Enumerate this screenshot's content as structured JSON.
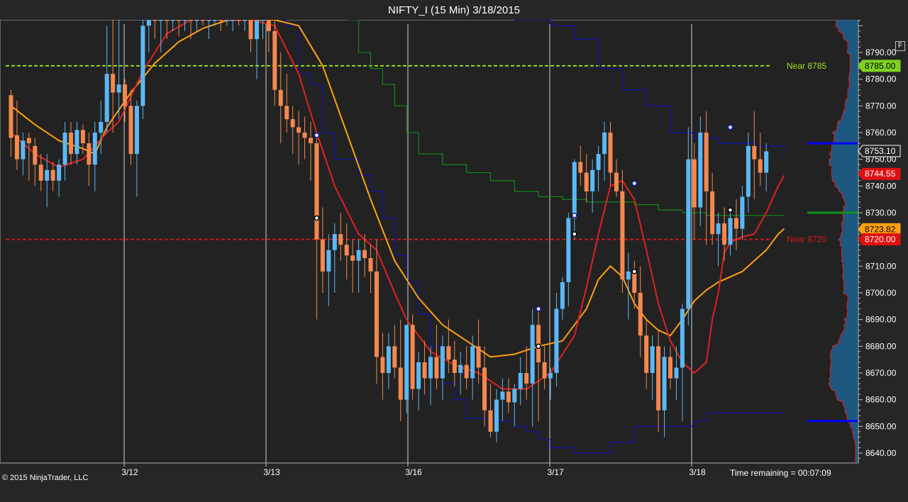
{
  "window": {
    "title": "NIFTY_I (15 Min)  3/18/2015",
    "f_button": "F"
  },
  "footer": {
    "copyright": "© 2015 NinjaTrader, LLC",
    "time_remaining": "Time remaining = 00:07:09"
  },
  "colors": {
    "background": "#262626",
    "panel": "#222222",
    "bar_up": "#5bb8f5",
    "bar_down": "#f5884e",
    "ema_fast": "#e02020",
    "ema_slow": "#ffa010",
    "band": "#1010b0",
    "vwap": "#10901a",
    "near_upper": "#a0e020",
    "near_lower": "#d01818",
    "profile": "#1d6aa0",
    "profile_outline": "#e02020"
  },
  "chart_data": {
    "type": "candlestick",
    "title": "NIFTY_I (15 Min)  3/18/2015",
    "y_range": [
      8635,
      8805
    ],
    "y_ticks": [
      8640,
      8650,
      8660,
      8670,
      8680,
      8690,
      8700,
      8710,
      8720,
      8730,
      8740,
      8750,
      8760,
      8770,
      8780,
      8790
    ],
    "x_day_labels": [
      "3/12",
      "3/13",
      "3/16",
      "3/17",
      "3/18"
    ],
    "grid": false,
    "near_levels": [
      {
        "label": "Near 8785",
        "value": 8785,
        "color": "#a0e020"
      },
      {
        "label": "Near 8720",
        "value": 8720,
        "color": "#d01818"
      }
    ],
    "price_markers": [
      {
        "label": "8785.00",
        "value": 8785,
        "style": "green"
      },
      {
        "label": "8753.10",
        "value": 8753.1,
        "style": "dark"
      },
      {
        "label": "8744.55",
        "value": 8744.55,
        "style": "red"
      },
      {
        "label": "8723.82",
        "value": 8723.82,
        "style": "orange"
      },
      {
        "label": "8720.00",
        "value": 8720,
        "style": "red"
      }
    ],
    "profile_levels": [
      {
        "value": 8756,
        "color": "#0000ff"
      },
      {
        "value": 8730,
        "color": "#10901a"
      },
      {
        "value": 8652,
        "color": "#0000ff"
      }
    ],
    "candles": [
      [
        8774,
        8776,
        8751,
        8758
      ],
      [
        8759,
        8772,
        8746,
        8750
      ],
      [
        8750,
        8760,
        8744,
        8757
      ],
      [
        8758,
        8760,
        8742,
        8756
      ],
      [
        8755,
        8758,
        8740,
        8748
      ],
      [
        8748,
        8752,
        8738,
        8742
      ],
      [
        8742,
        8752,
        8732,
        8746
      ],
      [
        8746,
        8749,
        8738,
        8742
      ],
      [
        8742,
        8750,
        8736,
        8748
      ],
      [
        8748,
        8764,
        8742,
        8760
      ],
      [
        8760,
        8764,
        8748,
        8752
      ],
      [
        8752,
        8764,
        8748,
        8761
      ],
      [
        8761,
        8763,
        8752,
        8756
      ],
      [
        8756,
        8760,
        8740,
        8748
      ],
      [
        8748,
        8764,
        8738,
        8760
      ],
      [
        8760,
        8772,
        8752,
        8764
      ],
      [
        8764,
        8800,
        8760,
        8782
      ],
      [
        8782,
        8806,
        8760,
        8775
      ],
      [
        8775,
        8806,
        8765,
        8778
      ],
      [
        8778,
        8780,
        8764,
        8770
      ],
      [
        8770,
        8776,
        8748,
        8752
      ],
      [
        8752,
        8772,
        8736,
        8770
      ],
      [
        8770,
        8805,
        8765,
        8800
      ],
      [
        8800,
        8806,
        8790,
        8805
      ],
      [
        8805,
        8806,
        8795,
        8802
      ],
      [
        8802,
        8806,
        8790,
        8804
      ],
      [
        8804,
        8806,
        8795,
        8803
      ],
      [
        8803,
        8806,
        8798,
        8805
      ],
      [
        8805,
        8806,
        8796,
        8803
      ],
      [
        8803,
        8806,
        8798,
        8805
      ],
      [
        8805,
        8806,
        8795,
        8804
      ],
      [
        8804,
        8806,
        8798,
        8805
      ],
      [
        8805,
        8806,
        8800,
        8803
      ],
      [
        8803,
        8806,
        8795,
        8804
      ],
      [
        8804,
        8806,
        8800,
        8805
      ],
      [
        8805,
        8806,
        8798,
        8803
      ],
      [
        8803,
        8806,
        8800,
        8805
      ],
      [
        8805,
        8806,
        8798,
        8806
      ],
      [
        8806,
        8806,
        8800,
        8804
      ],
      [
        8804,
        8806,
        8798,
        8805
      ],
      [
        8805,
        8806,
        8790,
        8795
      ],
      [
        8795,
        8806,
        8780,
        8802
      ],
      [
        8802,
        8806,
        8795,
        8806
      ],
      [
        8806,
        8806,
        8790,
        8798
      ],
      [
        8798,
        8806,
        8770,
        8776
      ],
      [
        8776,
        8790,
        8756,
        8770
      ],
      [
        8770,
        8782,
        8760,
        8765
      ],
      [
        8765,
        8770,
        8752,
        8762
      ],
      [
        8762,
        8768,
        8748,
        8760
      ],
      [
        8760,
        8766,
        8750,
        8758
      ],
      [
        8758,
        8764,
        8742,
        8756
      ],
      [
        8756,
        8760,
        8690,
        8720
      ],
      [
        8720,
        8732,
        8700,
        8708
      ],
      [
        8708,
        8722,
        8695,
        8716
      ],
      [
        8716,
        8726,
        8700,
        8722
      ],
      [
        8722,
        8730,
        8712,
        8718
      ],
      [
        8718,
        8726,
        8705,
        8714
      ],
      [
        8714,
        8720,
        8700,
        8712
      ],
      [
        8712,
        8720,
        8700,
        8716
      ],
      [
        8716,
        8722,
        8706,
        8713
      ],
      [
        8713,
        8718,
        8700,
        8708
      ],
      [
        8708,
        8720,
        8666,
        8676
      ],
      [
        8676,
        8685,
        8660,
        8670
      ],
      [
        8670,
        8685,
        8664,
        8680
      ],
      [
        8680,
        8688,
        8668,
        8672
      ],
      [
        8672,
        8690,
        8652,
        8660
      ],
      [
        8660,
        8688,
        8655,
        8688
      ],
      [
        8688,
        8692,
        8660,
        8664
      ],
      [
        8664,
        8678,
        8656,
        8674
      ],
      [
        8674,
        8682,
        8662,
        8668
      ],
      [
        8668,
        8680,
        8658,
        8676
      ],
      [
        8676,
        8688,
        8664,
        8668
      ],
      [
        8668,
        8684,
        8660,
        8680
      ],
      [
        8680,
        8690,
        8670,
        8675
      ],
      [
        8675,
        8682,
        8665,
        8670
      ],
      [
        8670,
        8678,
        8662,
        8673
      ],
      [
        8673,
        8680,
        8664,
        8668
      ],
      [
        8668,
        8684,
        8660,
        8680
      ],
      [
        8680,
        8690,
        8666,
        8672
      ],
      [
        8672,
        8680,
        8650,
        8656
      ],
      [
        8656,
        8666,
        8646,
        8648
      ],
      [
        8648,
        8664,
        8644,
        8660
      ],
      [
        8660,
        8668,
        8652,
        8663
      ],
      [
        8663,
        8668,
        8655,
        8659
      ],
      [
        8659,
        8666,
        8650,
        8664
      ],
      [
        8664,
        8676,
        8658,
        8670
      ],
      [
        8670,
        8680,
        8660,
        8666
      ],
      [
        8666,
        8694,
        8650,
        8688
      ],
      [
        8688,
        8694,
        8652,
        8674
      ],
      [
        8674,
        8680,
        8664,
        8668
      ],
      [
        8668,
        8672,
        8660,
        8670
      ],
      [
        8670,
        8700,
        8665,
        8694
      ],
      [
        8694,
        8706,
        8690,
        8704
      ],
      [
        8704,
        8730,
        8695,
        8728
      ],
      [
        8728,
        8750,
        8720,
        8749
      ],
      [
        8749,
        8755,
        8740,
        8745
      ],
      [
        8745,
        8752,
        8734,
        8738
      ],
      [
        8738,
        8750,
        8730,
        8746
      ],
      [
        8746,
        8755,
        8738,
        8752
      ],
      [
        8752,
        8764,
        8742,
        8760
      ],
      [
        8760,
        8764,
        8740,
        8745
      ],
      [
        8745,
        8750,
        8736,
        8738
      ],
      [
        8738,
        8746,
        8700,
        8705
      ],
      [
        8705,
        8715,
        8690,
        8708
      ],
      [
        8708,
        8712,
        8694,
        8700
      ],
      [
        8700,
        8710,
        8676,
        8684
      ],
      [
        8684,
        8690,
        8664,
        8670
      ],
      [
        8670,
        8684,
        8660,
        8680
      ],
      [
        8680,
        8686,
        8648,
        8656
      ],
      [
        8656,
        8680,
        8646,
        8676
      ],
      [
        8676,
        8680,
        8664,
        8668
      ],
      [
        8668,
        8680,
        8660,
        8672
      ],
      [
        8672,
        8696,
        8652,
        8694
      ],
      [
        8694,
        8762,
        8688,
        8750
      ],
      [
        8750,
        8756,
        8720,
        8732
      ],
      [
        8732,
        8766,
        8725,
        8760
      ],
      [
        8760,
        8768,
        8718,
        8738
      ],
      [
        8738,
        8745,
        8718,
        8722
      ],
      [
        8722,
        8730,
        8710,
        8726
      ],
      [
        8726,
        8732,
        8712,
        8718
      ],
      [
        8718,
        8732,
        8714,
        8728
      ],
      [
        8728,
        8735,
        8716,
        8724
      ],
      [
        8724,
        8740,
        8720,
        8736
      ],
      [
        8736,
        8760,
        8730,
        8755
      ],
      [
        8755,
        8768,
        8735,
        8750
      ],
      [
        8750,
        8760,
        8740,
        8745
      ],
      [
        8745,
        8756,
        8738,
        8753
      ]
    ],
    "ema_fast": [
      [
        0,
        8760
      ],
      [
        4,
        8752
      ],
      [
        8,
        8747
      ],
      [
        12,
        8750
      ],
      [
        14,
        8755
      ],
      [
        16,
        8760
      ],
      [
        18,
        8764
      ],
      [
        22,
        8783
      ],
      [
        26,
        8797
      ],
      [
        30,
        8804
      ],
      [
        40,
        8805
      ],
      [
        44,
        8800
      ],
      [
        48,
        8782
      ],
      [
        51,
        8760
      ],
      [
        54,
        8740
      ],
      [
        58,
        8722
      ],
      [
        61,
        8716
      ],
      [
        64,
        8700
      ],
      [
        66,
        8690
      ],
      [
        70,
        8678
      ],
      [
        74,
        8673
      ],
      [
        78,
        8670
      ],
      [
        82,
        8664
      ],
      [
        86,
        8664
      ],
      [
        90,
        8670
      ],
      [
        94,
        8684
      ],
      [
        96,
        8702
      ],
      [
        98,
        8722
      ],
      [
        100,
        8740
      ],
      [
        102,
        8742
      ],
      [
        104,
        8735
      ],
      [
        106,
        8716
      ],
      [
        108,
        8696
      ],
      [
        110,
        8682
      ],
      [
        112,
        8674
      ],
      [
        114,
        8670
      ],
      [
        116,
        8674
      ],
      [
        117,
        8690
      ],
      [
        118,
        8700
      ],
      [
        119,
        8715
      ],
      [
        120,
        8719
      ],
      [
        122,
        8721
      ],
      [
        124,
        8722
      ],
      [
        126,
        8730
      ],
      [
        128,
        8740
      ],
      [
        129,
        8744
      ]
    ],
    "ema_slow": [
      [
        0,
        8770
      ],
      [
        4,
        8763
      ],
      [
        8,
        8757
      ],
      [
        12,
        8754
      ],
      [
        14,
        8752
      ],
      [
        16,
        8762
      ],
      [
        20,
        8775
      ],
      [
        24,
        8786
      ],
      [
        28,
        8794
      ],
      [
        32,
        8799
      ],
      [
        36,
        8802
      ],
      [
        40,
        8806
      ],
      [
        44,
        8805
      ],
      [
        48,
        8800
      ],
      [
        52,
        8785
      ],
      [
        56,
        8760
      ],
      [
        60,
        8735
      ],
      [
        64,
        8712
      ],
      [
        68,
        8698
      ],
      [
        72,
        8688
      ],
      [
        76,
        8682
      ],
      [
        80,
        8676
      ],
      [
        84,
        8677
      ],
      [
        88,
        8680
      ],
      [
        92,
        8682
      ],
      [
        94,
        8688
      ],
      [
        96,
        8694
      ],
      [
        98,
        8705
      ],
      [
        100,
        8710
      ],
      [
        102,
        8706
      ],
      [
        104,
        8696
      ],
      [
        106,
        8690
      ],
      [
        108,
        8686
      ],
      [
        110,
        8684
      ],
      [
        112,
        8690
      ],
      [
        114,
        8697
      ],
      [
        116,
        8701
      ],
      [
        118,
        8704
      ],
      [
        120,
        8706
      ],
      [
        122,
        8708
      ],
      [
        124,
        8712
      ],
      [
        126,
        8716
      ],
      [
        128,
        8722
      ],
      [
        129,
        8724
      ]
    ],
    "band": [
      [
        40,
        8806
      ],
      [
        46,
        8800
      ],
      [
        48,
        8782
      ],
      [
        50,
        8778
      ],
      [
        52,
        8760
      ],
      [
        54,
        8750
      ],
      [
        58,
        8744
      ],
      [
        60,
        8738
      ],
      [
        62,
        8728
      ],
      [
        64,
        8714
      ],
      [
        66,
        8704
      ],
      [
        68,
        8692
      ],
      [
        70,
        8680
      ],
      [
        72,
        8666
      ],
      [
        74,
        8660
      ],
      [
        76,
        8653
      ],
      [
        80,
        8652
      ],
      [
        84,
        8650
      ],
      [
        86,
        8648
      ],
      [
        88,
        8645
      ],
      [
        90,
        8642
      ],
      [
        94,
        8640
      ],
      [
        100,
        8644
      ],
      [
        104,
        8650
      ],
      [
        108,
        8650
      ],
      [
        112,
        8650
      ],
      [
        114,
        8652
      ],
      [
        116,
        8655
      ],
      [
        129,
        8655
      ]
    ],
    "band_upper": [
      [
        84,
        8806
      ],
      [
        90,
        8800
      ],
      [
        94,
        8795
      ],
      [
        98,
        8784
      ],
      [
        102,
        8776
      ],
      [
        106,
        8770
      ],
      [
        110,
        8760
      ],
      [
        114,
        8758
      ],
      [
        118,
        8756
      ],
      [
        124,
        8755
      ],
      [
        129,
        8752
      ]
    ],
    "vwap": [
      [
        56,
        8806
      ],
      [
        58,
        8790
      ],
      [
        60,
        8784
      ],
      [
        62,
        8778
      ],
      [
        64,
        8770
      ],
      [
        66,
        8760
      ],
      [
        68,
        8752
      ],
      [
        72,
        8748
      ],
      [
        76,
        8745
      ],
      [
        80,
        8742
      ],
      [
        84,
        8738
      ],
      [
        88,
        8736
      ],
      [
        92,
        8735
      ],
      [
        96,
        8734
      ],
      [
        100,
        8734
      ],
      [
        104,
        8733
      ],
      [
        108,
        8731
      ],
      [
        112,
        8730
      ],
      [
        116,
        8729
      ],
      [
        120,
        8729
      ],
      [
        124,
        8729
      ],
      [
        129,
        8729
      ]
    ],
    "markers": [
      {
        "i": 51,
        "value": 8759,
        "ring": "blue"
      },
      {
        "i": 51,
        "value": 8728,
        "ring": "black"
      },
      {
        "i": 88,
        "value": 8694,
        "ring": "blue"
      },
      {
        "i": 88,
        "value": 8680,
        "ring": "black"
      },
      {
        "i": 94,
        "value": 8729,
        "ring": "blue"
      },
      {
        "i": 94,
        "value": 8722,
        "ring": "black"
      },
      {
        "i": 104,
        "value": 8741,
        "ring": "blue"
      },
      {
        "i": 104,
        "value": 8708,
        "ring": "black"
      },
      {
        "i": 120,
        "value": 8762,
        "ring": "blue"
      },
      {
        "i": 120,
        "value": 8731,
        "ring": "black"
      }
    ]
  }
}
